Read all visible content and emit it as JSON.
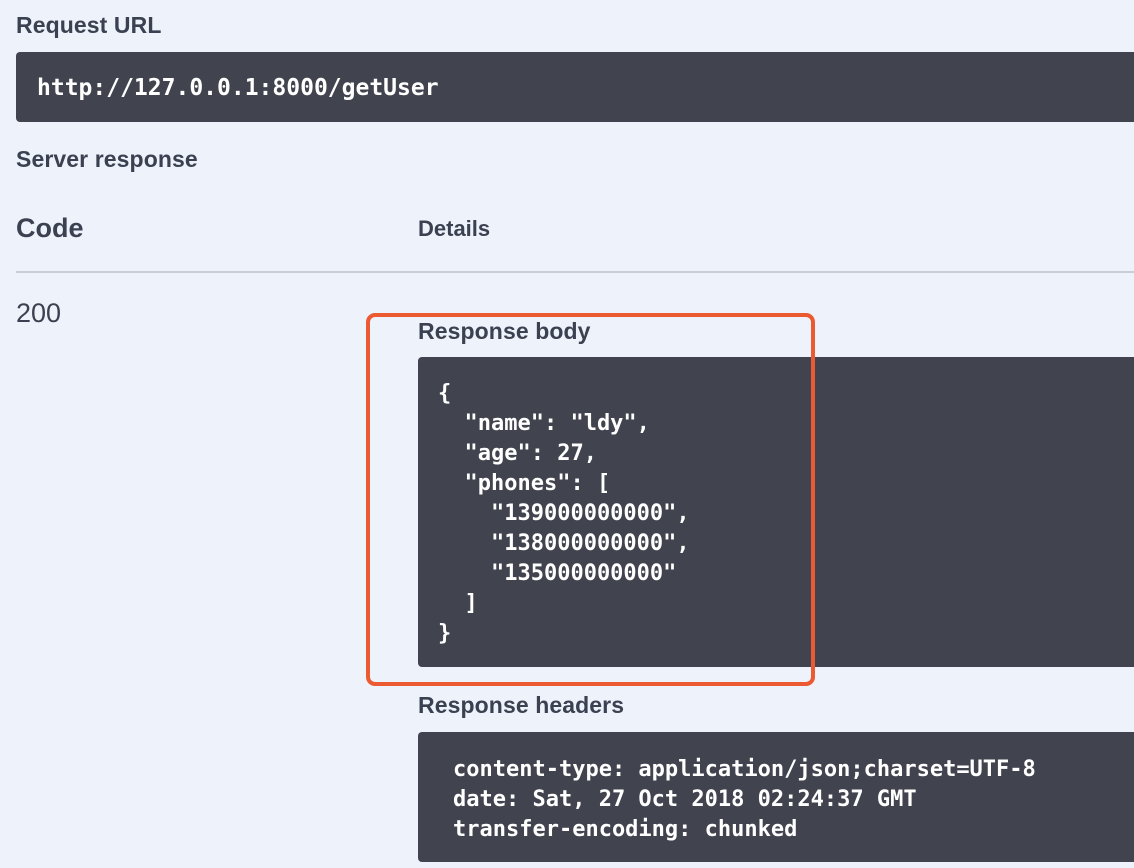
{
  "request_url": {
    "label": "Request URL",
    "value": "http://127.0.0.1:8000/getUser"
  },
  "server_response": {
    "label": "Server response",
    "columns": {
      "code": "Code",
      "details": "Details"
    },
    "status_code": "200",
    "response_body": {
      "label": "Response body",
      "content": "{\n  \"name\": \"ldy\",\n  \"age\": 27,\n  \"phones\": [\n    \"139000000000\",\n    \"138000000000\",\n    \"135000000000\"\n  ]\n}"
    },
    "response_headers": {
      "label": "Response headers",
      "content": "content-type: application/json;charset=UTF-8\ndate: Sat, 27 Oct 2018 02:24:37 GMT\ntransfer-encoding: chunked"
    }
  },
  "annotation": {
    "highlight_color": "#ec5a32"
  },
  "colors": {
    "background": "#eef3fb",
    "code_background": "#41444e",
    "text": "#3b4151"
  }
}
